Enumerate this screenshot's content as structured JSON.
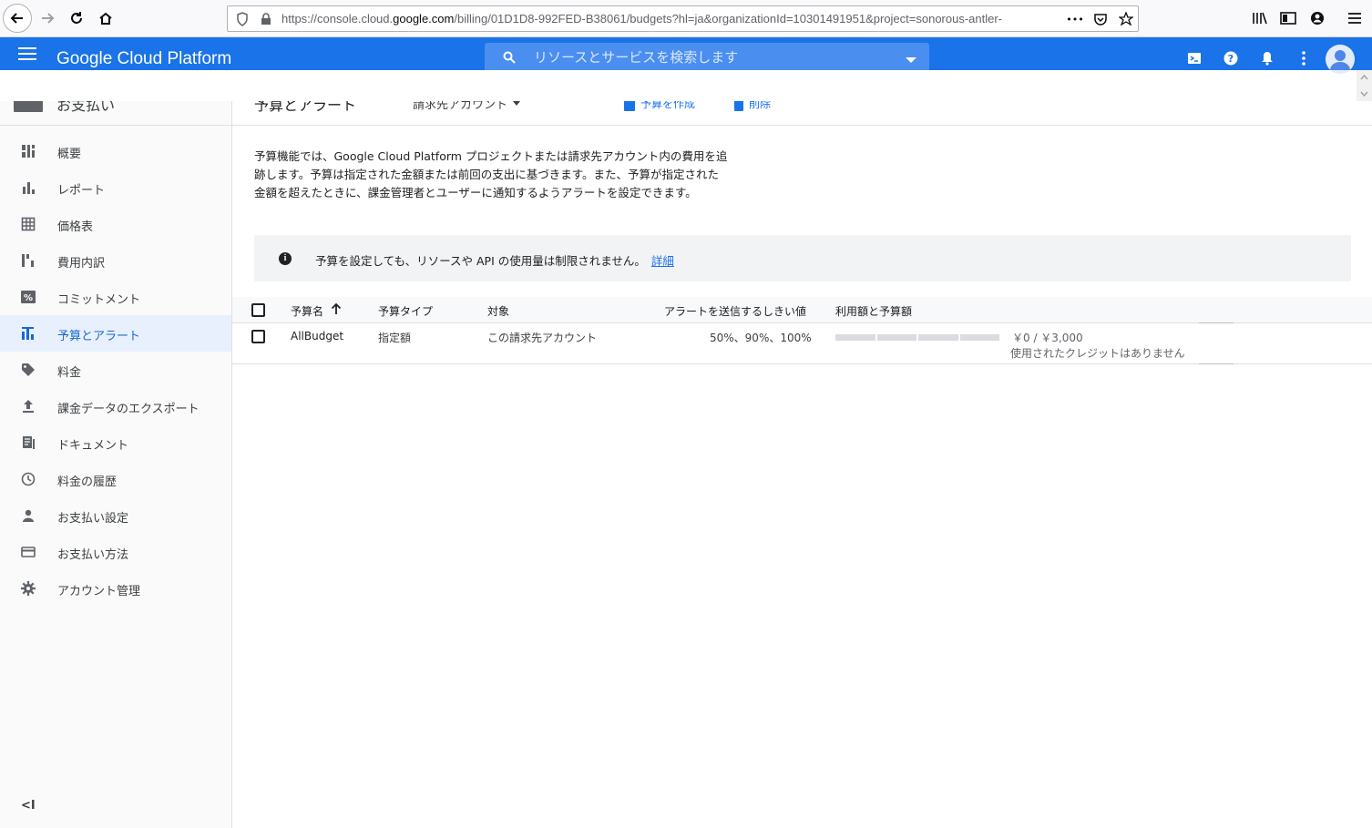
{
  "browser": {
    "url_prefix": "https://console.cloud.",
    "url_domain": "google.com",
    "url_suffix": "/billing/01D1D8-992FED-B38061/budgets?hl=ja&organizationId=10301491951&project=sonorous-antler-",
    "more_label": "•••"
  },
  "header": {
    "product_title": "Google Cloud Platform",
    "search_placeholder": "リソースとサービスを検索します"
  },
  "sidebar": {
    "title": "お支払い",
    "items": [
      {
        "label": "概要",
        "icon": "dashboard-icon"
      },
      {
        "label": "レポート",
        "icon": "bar-chart-icon"
      },
      {
        "label": "価格表",
        "icon": "table-icon"
      },
      {
        "label": "費用内訳",
        "icon": "breakdown-icon"
      },
      {
        "label": "コミットメント",
        "icon": "percent-icon"
      },
      {
        "label": "予算とアラート",
        "icon": "budget-icon",
        "active": true
      },
      {
        "label": "料金",
        "icon": "tag-icon"
      },
      {
        "label": "課金データのエクスポート",
        "icon": "upload-icon"
      },
      {
        "label": "ドキュメント",
        "icon": "document-icon"
      },
      {
        "label": "料金の履歴",
        "icon": "clock-icon"
      },
      {
        "label": "お支払い設定",
        "icon": "person-icon"
      },
      {
        "label": "お支払い方法",
        "icon": "credit-card-icon"
      },
      {
        "label": "アカウント管理",
        "icon": "gear-icon"
      }
    ],
    "collapse_label": "<I"
  },
  "toolbar": {
    "page_title": "予算とアラート",
    "account_label": "請求先アカウント",
    "create_label": "予算を作成",
    "delete_label": "削除"
  },
  "main": {
    "description": "予算機能では、Google Cloud Platform プロジェクトまたは請求先アカウント内の費用を追跡します。予算は指定された金額または前回の支出に基づきます。また、予算が指定された金額を超えたときに、課金管理者とユーザーに通知するようアラートを設定できます。",
    "info_text": "予算を設定しても、リソースや API の使用量は制限されません。",
    "info_link": "詳細"
  },
  "table": {
    "headers": {
      "name": "予算名",
      "type": "予算タイプ",
      "target": "対象",
      "thresholds": "アラートを送信するしきい値",
      "usage": "利用額と予算額"
    },
    "rows": [
      {
        "name": "AllBudget",
        "type": "指定額",
        "target": "この請求先アカウント",
        "thresholds": "50%、90%、100%",
        "amount": "￥0 / ￥3,000",
        "progress": 0,
        "credit_note": "使用されたクレジットはありません"
      }
    ]
  },
  "colors": {
    "brand_blue": "#1a73e8",
    "active_bg": "#e8f0fe"
  }
}
